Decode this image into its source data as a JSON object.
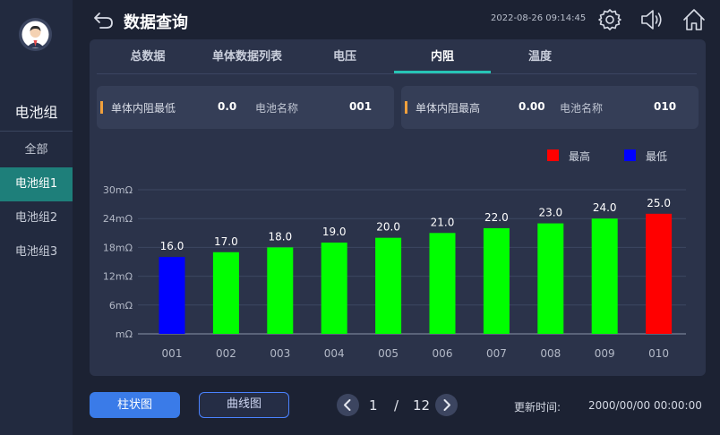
{
  "header": {
    "title": "数据查询",
    "datetime": "2022-08-26 09:14:45"
  },
  "sidebar": {
    "group_title": "电池组",
    "items": [
      {
        "label": "全部",
        "active": false
      },
      {
        "label": "电池组1",
        "active": true
      },
      {
        "label": "电池组2",
        "active": false
      },
      {
        "label": "电池组3",
        "active": false
      }
    ]
  },
  "tabs": [
    {
      "label": "总数据",
      "active": false
    },
    {
      "label": "单体数据列表",
      "active": false
    },
    {
      "label": "电压",
      "active": false
    },
    {
      "label": "内阻",
      "active": true
    },
    {
      "label": "温度",
      "active": false
    }
  ],
  "stats": {
    "min": {
      "label": "单体内阻最低",
      "value": "0.0",
      "name_label": "电池名称",
      "name_value": "001"
    },
    "max": {
      "label": "单体内阻最高",
      "value": "0.00",
      "name_label": "电池名称",
      "name_value": "010"
    }
  },
  "legend": {
    "max_label": "最高",
    "min_label": "最低",
    "max_color": "#ff0000",
    "min_color": "#0000ff"
  },
  "chart_data": {
    "type": "bar",
    "categories": [
      "001",
      "002",
      "003",
      "004",
      "005",
      "006",
      "007",
      "008",
      "009",
      "010"
    ],
    "values": [
      16.0,
      17.0,
      18.0,
      19.0,
      20.0,
      21.0,
      22.0,
      23.0,
      24.0,
      25.0
    ],
    "value_labels": [
      "16.0",
      "17.0",
      "18.0",
      "19.0",
      "20.0",
      "21.0",
      "22.0",
      "23.0",
      "24.0",
      "25.0"
    ],
    "y_ticks": [
      0,
      6,
      12,
      18,
      24,
      30
    ],
    "y_tick_labels": [
      "mΩ",
      "6mΩ",
      "12mΩ",
      "18mΩ",
      "24mΩ",
      "30mΩ"
    ],
    "ylim": [
      0,
      30
    ],
    "colors": [
      "#0000ff",
      "#00ff00",
      "#00ff00",
      "#00ff00",
      "#00ff00",
      "#00ff00",
      "#00ff00",
      "#00ff00",
      "#00ff00",
      "#ff0000"
    ],
    "grid": true
  },
  "buttons": {
    "bar_chart": "柱状图",
    "line_chart": "曲线图"
  },
  "pagination": {
    "current": "1",
    "separator": "/",
    "total": "12"
  },
  "update": {
    "label": "更新时间:",
    "value": "2000/00/00 00:00:00"
  },
  "icons": {
    "back": "back-arrow-icon",
    "settings": "gear-icon",
    "sound": "speaker-icon",
    "home": "home-icon"
  }
}
